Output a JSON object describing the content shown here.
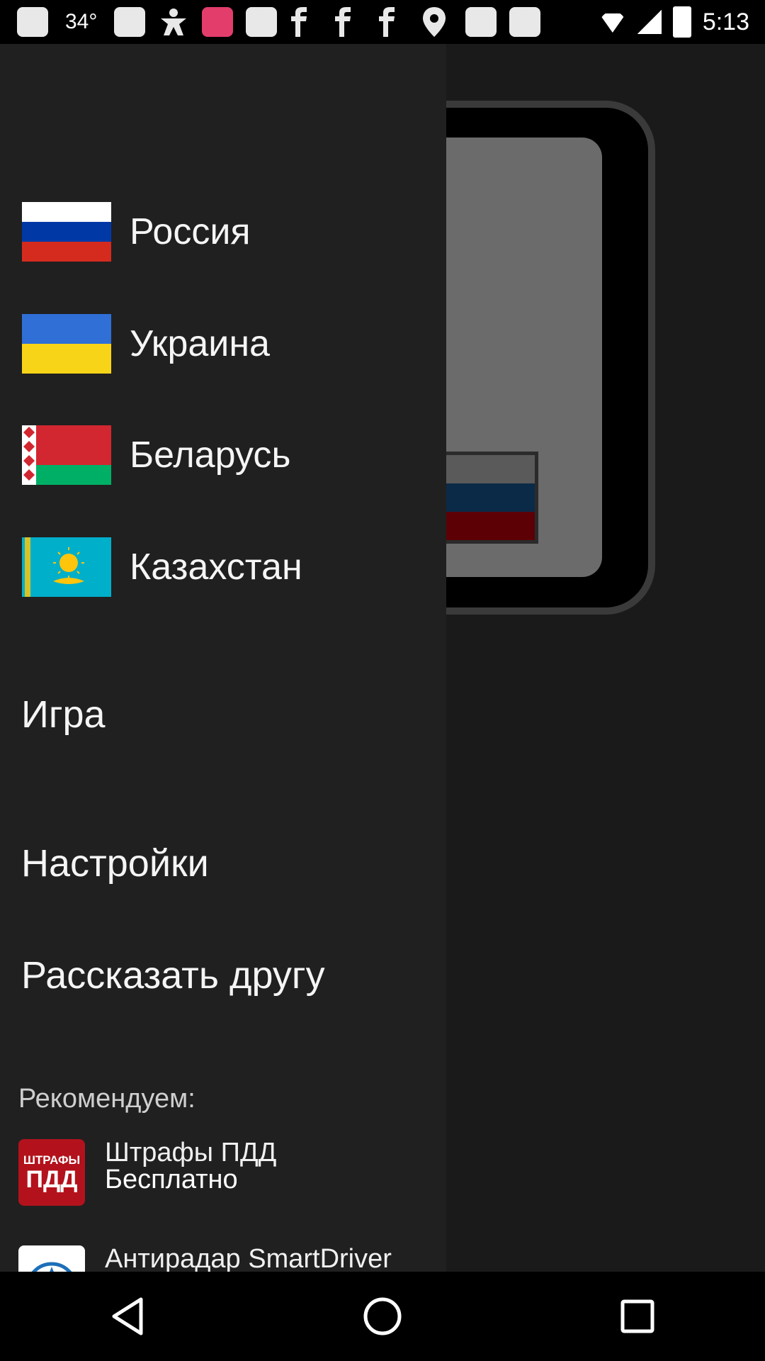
{
  "status_bar": {
    "temperature": "34°",
    "time": "5:13"
  },
  "drawer": {
    "countries": [
      {
        "label": "Россия"
      },
      {
        "label": "Украина"
      },
      {
        "label": "Беларусь"
      },
      {
        "label": "Казахстан"
      }
    ],
    "menu": [
      {
        "label": "Игра"
      },
      {
        "label": "Настройки"
      },
      {
        "label": "Рассказать другу"
      }
    ],
    "recommend_title": "Рекомендуем:",
    "promos": [
      {
        "icon_text_1": "ШТРАФЫ",
        "icon_text_2": "ПДД",
        "line1": "Штрафы ПДД",
        "line2": "Бесплатно"
      },
      {
        "line1": "Антирадар SmartDriver"
      }
    ]
  },
  "colors": {
    "drawer_bg": "#202020",
    "russia": [
      "#ffffff",
      "#0039a6",
      "#d52b1e"
    ],
    "ukraine": [
      "#2f6fd6",
      "#f7d417"
    ],
    "belarus": [
      "#d22730",
      "#00af66"
    ],
    "kazakhstan": [
      "#00afca",
      "#fec50c"
    ]
  }
}
